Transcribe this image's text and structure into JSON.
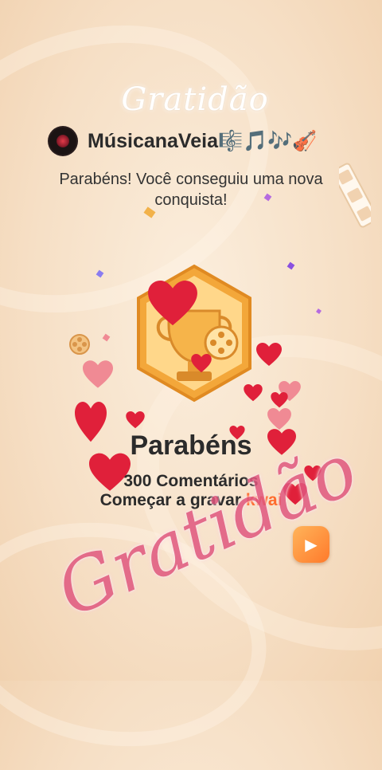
{
  "decor_top_script": "Gratidão",
  "author": {
    "name": "MúsicanaVeia",
    "name_emojis": "🎼🎵🎶🎻"
  },
  "message": "Parabéns! Você conseguiu uma nova conquista!",
  "achievement": {
    "title": "Parabéns",
    "count_line": "300 Comentários",
    "cta_text": "Começar a gravar",
    "brand": "kwai"
  },
  "decor_bottom_script": "Gratidão",
  "colors": {
    "heart": "#e0203a",
    "heart_pink": "#f08a94",
    "badge_gold": "#f3a73a",
    "badge_light": "#ffe3a6",
    "script_pink": "#e0577f"
  }
}
